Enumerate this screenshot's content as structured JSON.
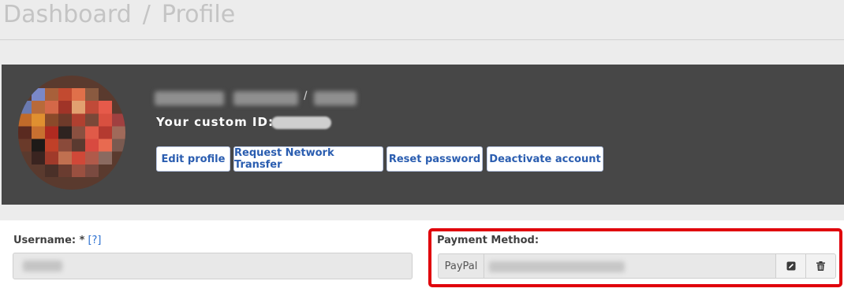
{
  "breadcrumb": {
    "items": [
      "Dashboard",
      "Profile"
    ],
    "separator": "/"
  },
  "profile": {
    "name_separator": "/",
    "custom_id_label": "Your custom ID:"
  },
  "actions": {
    "edit_profile": "Edit profile",
    "request_transfer": "Request Network Transfer",
    "reset_password": "Reset password",
    "deactivate": "Deactivate account"
  },
  "form": {
    "username_label": "Username: *",
    "username_help": "[?]",
    "payment_label": "Payment Method:",
    "payment_addon": "PayPal"
  },
  "icons": {
    "edit": "edit-icon",
    "delete": "trash-icon"
  },
  "colors": {
    "banner": "#474747",
    "accent": "#2a5db0",
    "highlight": "#e0000b"
  }
}
